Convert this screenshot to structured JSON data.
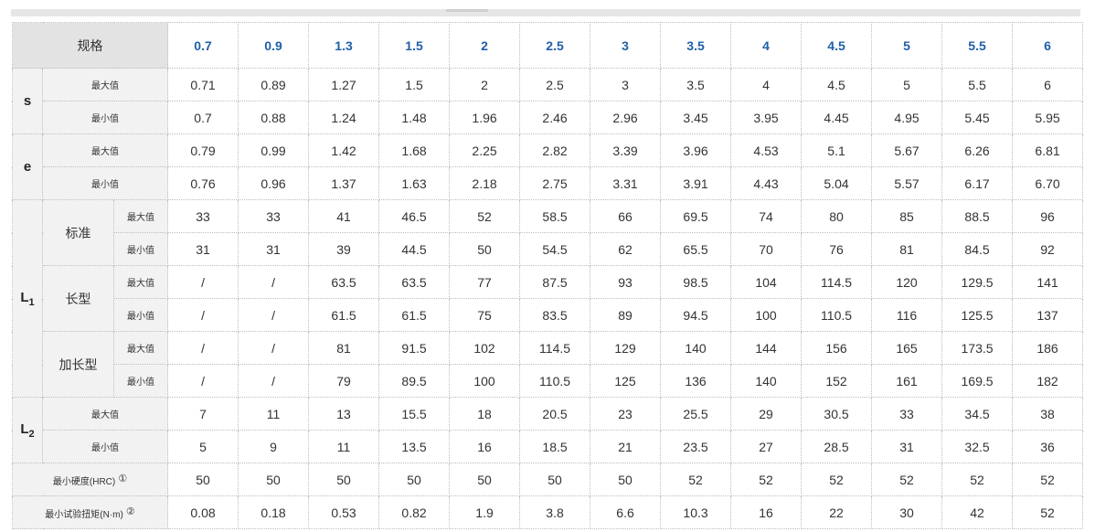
{
  "table": {
    "spec_label": "规格",
    "sizes": [
      "0.7",
      "0.9",
      "1.3",
      "1.5",
      "2",
      "2.5",
      "3",
      "3.5",
      "4",
      "4.5",
      "5",
      "5.5",
      "6"
    ],
    "labels": {
      "s": "s",
      "e": "e",
      "L1": "L",
      "L1_sub": "1",
      "L2": "L",
      "L2_sub": "2",
      "max": "最大值",
      "min": "最小值",
      "standard": "标准",
      "long": "长型",
      "extra_long": "加长型",
      "hardness": "最小硬度(HRC)",
      "hardness_mark": "①",
      "torque": "最小试验扭矩(N·m)",
      "torque_mark": "②"
    },
    "rows": {
      "s_max": [
        "0.71",
        "0.89",
        "1.27",
        "1.5",
        "2",
        "2.5",
        "3",
        "3.5",
        "4",
        "4.5",
        "5",
        "5.5",
        "6"
      ],
      "s_min": [
        "0.7",
        "0.88",
        "1.24",
        "1.48",
        "1.96",
        "2.46",
        "2.96",
        "3.45",
        "3.95",
        "4.45",
        "4.95",
        "5.45",
        "5.95"
      ],
      "e_max": [
        "0.79",
        "0.99",
        "1.42",
        "1.68",
        "2.25",
        "2.82",
        "3.39",
        "3.96",
        "4.53",
        "5.1",
        "5.67",
        "6.26",
        "6.81"
      ],
      "e_min": [
        "0.76",
        "0.96",
        "1.37",
        "1.63",
        "2.18",
        "2.75",
        "3.31",
        "3.91",
        "4.43",
        "5.04",
        "5.57",
        "6.17",
        "6.70"
      ],
      "l1_std_max": [
        "33",
        "33",
        "41",
        "46.5",
        "52",
        "58.5",
        "66",
        "69.5",
        "74",
        "80",
        "85",
        "88.5",
        "96"
      ],
      "l1_std_min": [
        "31",
        "31",
        "39",
        "44.5",
        "50",
        "54.5",
        "62",
        "65.5",
        "70",
        "76",
        "81",
        "84.5",
        "92"
      ],
      "l1_long_max": [
        "/",
        "/",
        "63.5",
        "63.5",
        "77",
        "87.5",
        "93",
        "98.5",
        "104",
        "114.5",
        "120",
        "129.5",
        "141"
      ],
      "l1_long_min": [
        "/",
        "/",
        "61.5",
        "61.5",
        "75",
        "83.5",
        "89",
        "94.5",
        "100",
        "110.5",
        "116",
        "125.5",
        "137"
      ],
      "l1_xl_max": [
        "/",
        "/",
        "81",
        "91.5",
        "102",
        "114.5",
        "129",
        "140",
        "144",
        "156",
        "165",
        "173.5",
        "186"
      ],
      "l1_xl_min": [
        "/",
        "/",
        "79",
        "89.5",
        "100",
        "110.5",
        "125",
        "136",
        "140",
        "152",
        "161",
        "169.5",
        "182"
      ],
      "l2_max": [
        "7",
        "11",
        "13",
        "15.5",
        "18",
        "20.5",
        "23",
        "25.5",
        "29",
        "30.5",
        "33",
        "34.5",
        "38"
      ],
      "l2_min": [
        "5",
        "9",
        "11",
        "13.5",
        "16",
        "18.5",
        "21",
        "23.5",
        "27",
        "28.5",
        "31",
        "32.5",
        "36"
      ],
      "hardness": [
        "50",
        "50",
        "50",
        "50",
        "50",
        "50",
        "50",
        "52",
        "52",
        "52",
        "52",
        "52",
        "52"
      ],
      "torque": [
        "0.08",
        "0.18",
        "0.53",
        "0.82",
        "1.9",
        "3.8",
        "6.6",
        "10.3",
        "16",
        "22",
        "30",
        "42",
        "52"
      ]
    }
  }
}
